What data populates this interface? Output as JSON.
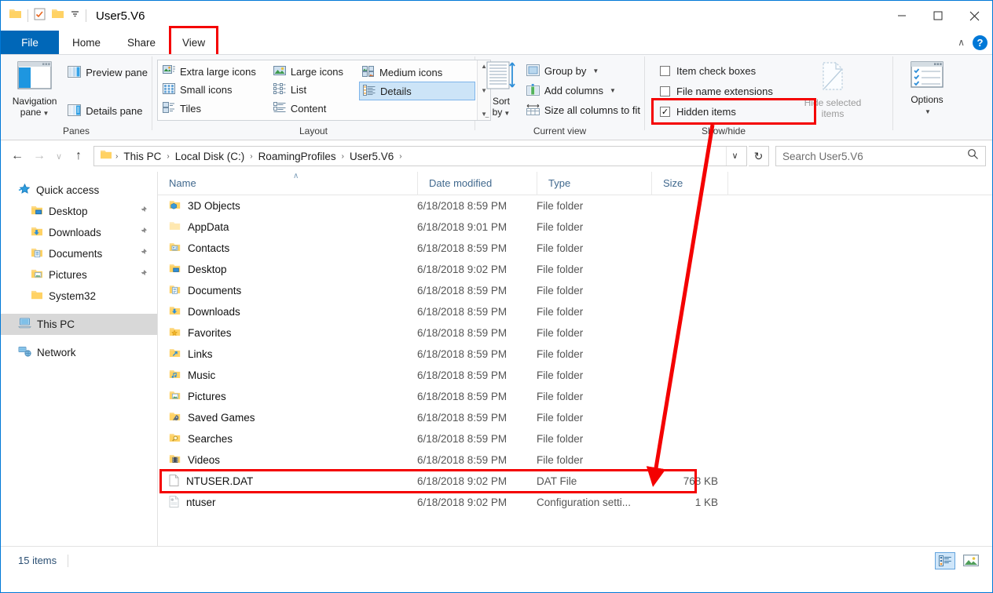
{
  "window": {
    "title": "User5.V6",
    "minimize_label": "–",
    "maximize_label": "☐",
    "close_label": "✕",
    "ribbon_collapse_label": "∧",
    "help_label": "?"
  },
  "tabs": [
    {
      "label": "File",
      "id": "file"
    },
    {
      "label": "Home",
      "id": "home"
    },
    {
      "label": "Share",
      "id": "share"
    },
    {
      "label": "View",
      "id": "view",
      "highlighted": true
    }
  ],
  "ribbon": {
    "groups": [
      {
        "caption": "Panes"
      },
      {
        "caption": "Layout"
      },
      {
        "caption": "Current view"
      },
      {
        "caption": "Show/hide"
      }
    ],
    "panes": {
      "navigation_pane": "Navigation\npane",
      "navigation_pane_line1": "Navigation",
      "navigation_pane_line2": "pane",
      "preview_pane": "Preview pane",
      "details_pane": "Details pane"
    },
    "layout": {
      "items": [
        "Extra large icons",
        "Large icons",
        "Medium icons",
        "Small icons",
        "List",
        "Details",
        "Tiles",
        "Content"
      ],
      "selected": "Details",
      "scroll_up": "▲",
      "scroll_down": "▼",
      "scroll_more": "▼"
    },
    "current_view": {
      "sort_by_line1": "Sort",
      "sort_by_line2": "by",
      "group_by": "Group by",
      "add_columns": "Add columns",
      "size_all_columns": "Size all columns to fit"
    },
    "show_hide": {
      "item_check_boxes": {
        "label": "Item check boxes",
        "checked": false
      },
      "file_name_extensions": {
        "label": "File name extensions",
        "checked": false
      },
      "hidden_items": {
        "label": "Hidden items",
        "checked": true,
        "highlighted": true
      },
      "hide_selected_items_line1": "Hide selected",
      "hide_selected_items_line2": "items",
      "options": "Options"
    }
  },
  "addressbar": {
    "back": "←",
    "forward": "→",
    "recent": "∨",
    "up": "↑",
    "breadcrumbs": [
      "This PC",
      "Local Disk (C:)",
      "RoamingProfiles",
      "User5.V6"
    ],
    "separator": "›",
    "dropdown": "∨",
    "refresh": "↻",
    "search_placeholder": "Search User5.V6",
    "search_value": ""
  },
  "sidebar": {
    "items": [
      {
        "label": "Quick access",
        "icon": "star-icon",
        "level": 0,
        "pinned": false,
        "selected": false
      },
      {
        "label": "Desktop",
        "icon": "desktop-folder-icon",
        "level": 1,
        "pinned": true,
        "selected": false
      },
      {
        "label": "Downloads",
        "icon": "downloads-folder-icon",
        "level": 1,
        "pinned": true,
        "selected": false
      },
      {
        "label": "Documents",
        "icon": "documents-folder-icon",
        "level": 1,
        "pinned": true,
        "selected": false
      },
      {
        "label": "Pictures",
        "icon": "pictures-folder-icon",
        "level": 1,
        "pinned": true,
        "selected": false
      },
      {
        "label": "System32",
        "icon": "folder-icon",
        "level": 1,
        "pinned": false,
        "selected": false
      },
      {
        "label": "This PC",
        "icon": "this-pc-icon",
        "level": 0,
        "pinned": false,
        "selected": true
      },
      {
        "label": "Network",
        "icon": "network-icon",
        "level": 0,
        "pinned": false,
        "selected": false
      }
    ],
    "pin_glyph": "📌"
  },
  "filelist": {
    "columns": [
      "Name",
      "Date modified",
      "Type",
      "Size"
    ],
    "sort_indicator": "∧",
    "rows": [
      {
        "name": "3D Objects",
        "date": "6/18/2018 8:59 PM",
        "type": "File folder",
        "size": "",
        "icon": "3d-objects-folder-icon"
      },
      {
        "name": "AppData",
        "date": "6/18/2018 9:01 PM",
        "type": "File folder",
        "size": "",
        "icon": "hidden-folder-icon"
      },
      {
        "name": "Contacts",
        "date": "6/18/2018 8:59 PM",
        "type": "File folder",
        "size": "",
        "icon": "contacts-folder-icon"
      },
      {
        "name": "Desktop",
        "date": "6/18/2018 9:02 PM",
        "type": "File folder",
        "size": "",
        "icon": "desktop-folder-icon"
      },
      {
        "name": "Documents",
        "date": "6/18/2018 8:59 PM",
        "type": "File folder",
        "size": "",
        "icon": "documents-folder-icon"
      },
      {
        "name": "Downloads",
        "date": "6/18/2018 8:59 PM",
        "type": "File folder",
        "size": "",
        "icon": "downloads-folder-icon"
      },
      {
        "name": "Favorites",
        "date": "6/18/2018 8:59 PM",
        "type": "File folder",
        "size": "",
        "icon": "favorites-folder-icon"
      },
      {
        "name": "Links",
        "date": "6/18/2018 8:59 PM",
        "type": "File folder",
        "size": "",
        "icon": "links-folder-icon"
      },
      {
        "name": "Music",
        "date": "6/18/2018 8:59 PM",
        "type": "File folder",
        "size": "",
        "icon": "music-folder-icon"
      },
      {
        "name": "Pictures",
        "date": "6/18/2018 8:59 PM",
        "type": "File folder",
        "size": "",
        "icon": "pictures-folder-icon"
      },
      {
        "name": "Saved Games",
        "date": "6/18/2018 8:59 PM",
        "type": "File folder",
        "size": "",
        "icon": "saved-games-folder-icon"
      },
      {
        "name": "Searches",
        "date": "6/18/2018 8:59 PM",
        "type": "File folder",
        "size": "",
        "icon": "searches-folder-icon"
      },
      {
        "name": "Videos",
        "date": "6/18/2018 8:59 PM",
        "type": "File folder",
        "size": "",
        "icon": "videos-folder-icon"
      },
      {
        "name": "NTUSER.DAT",
        "date": "6/18/2018 9:02 PM",
        "type": "DAT File",
        "size": "768 KB",
        "icon": "blank-file-icon",
        "highlighted": true
      },
      {
        "name": "ntuser",
        "date": "6/18/2018 9:02 PM",
        "type": "Configuration setti...",
        "size": "1 KB",
        "icon": "config-file-icon"
      }
    ]
  },
  "statusbar": {
    "item_count": "15 items",
    "details_view_icon": "details-view-icon",
    "large-icons_view_icon": "large-icons-view-icon"
  },
  "annotation": {
    "color": "#f40000",
    "arrow_from": "Hidden items checkbox",
    "arrow_to": "NTUSER.DAT row"
  }
}
